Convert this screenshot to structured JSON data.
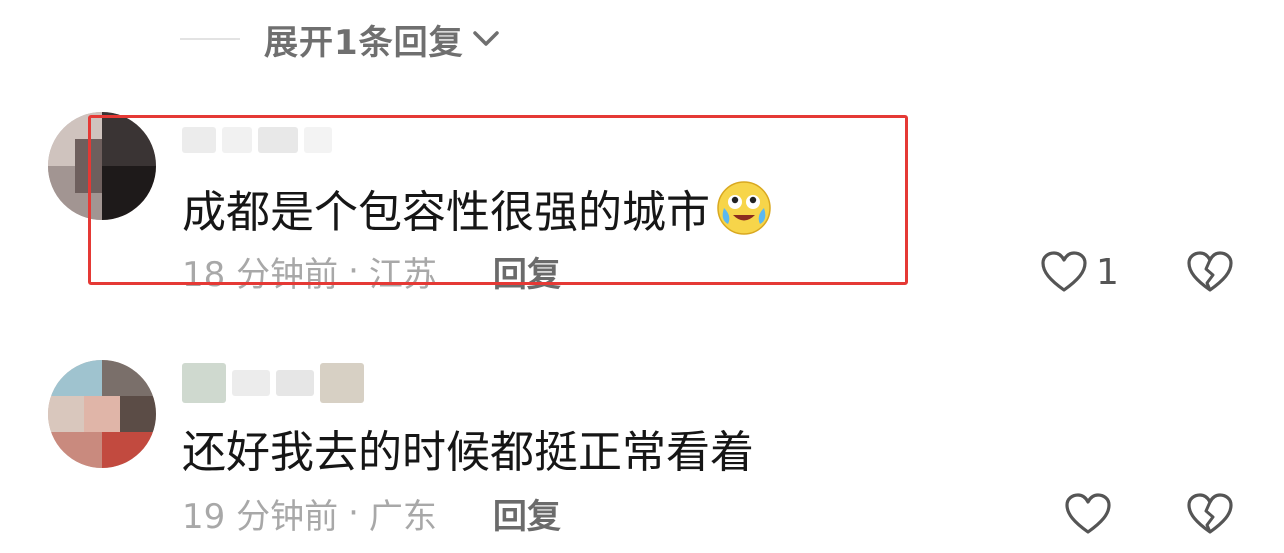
{
  "expand": {
    "label": "展开1条回复"
  },
  "comments": [
    {
      "text": "成都是个包容性很强的城市",
      "time": "18 分钟前",
      "sep": "·",
      "location": "江苏",
      "reply": "回复",
      "likes": "1",
      "emoji": "crying-laughing-face-icon"
    },
    {
      "text": "还好我去的时候都挺正常看着",
      "time": "19 分钟前",
      "sep": "·",
      "location": "广东",
      "reply": "回复",
      "likes": ""
    }
  ],
  "colors": {
    "highlight": "#e53935",
    "text": "#161616",
    "meta": "#a8a8a8"
  }
}
